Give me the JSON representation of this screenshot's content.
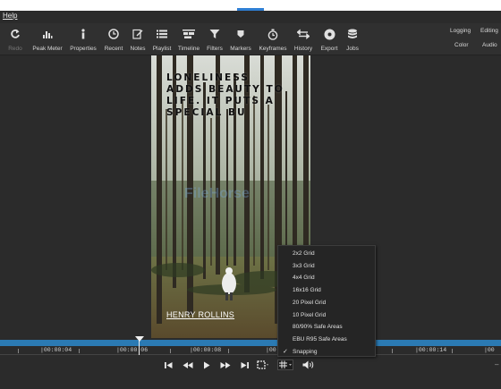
{
  "menu": {
    "help": "Help"
  },
  "toolbar": {
    "redo": "Redo",
    "peak_meter": "Peak Meter",
    "properties": "Properties",
    "recent": "Recent",
    "notes": "Notes",
    "playlist": "Playlist",
    "timeline": "Timeline",
    "filters": "Filters",
    "markers": "Markers",
    "keyframes": "Keyframes",
    "history": "History",
    "export": "Export",
    "jobs": "Jobs",
    "logging": "Logging",
    "editing": "Editing",
    "color": "Color",
    "audio": "Audio"
  },
  "preview": {
    "quote_lines": [
      "LONELINESS",
      "ADDS BEAUTY TO",
      "LIFE. IT PUTS A",
      "SPECIAL BU"
    ],
    "author": "HENRY ROLLINS",
    "watermark": "FileHorse"
  },
  "timeline": {
    "timecodes": [
      "|00:00:04",
      "|00:00:06",
      "|00:00:08",
      "|00:",
      "|00:00:14"
    ]
  },
  "grid_menu": {
    "items": [
      "2x2 Grid",
      "3x3 Grid",
      "4x4 Grid",
      "16x16 Grid",
      "20 Pixel Grid",
      "10 Pixel Grid",
      "80/90% Safe Areas",
      "EBU R95 Safe Areas",
      "Snapping"
    ],
    "checked": "Snapping",
    "checkmark": "✓"
  },
  "colors": {
    "accent": "#2b7ab3",
    "menu_bg": "#252525",
    "app_bg": "#2b2b2b"
  }
}
